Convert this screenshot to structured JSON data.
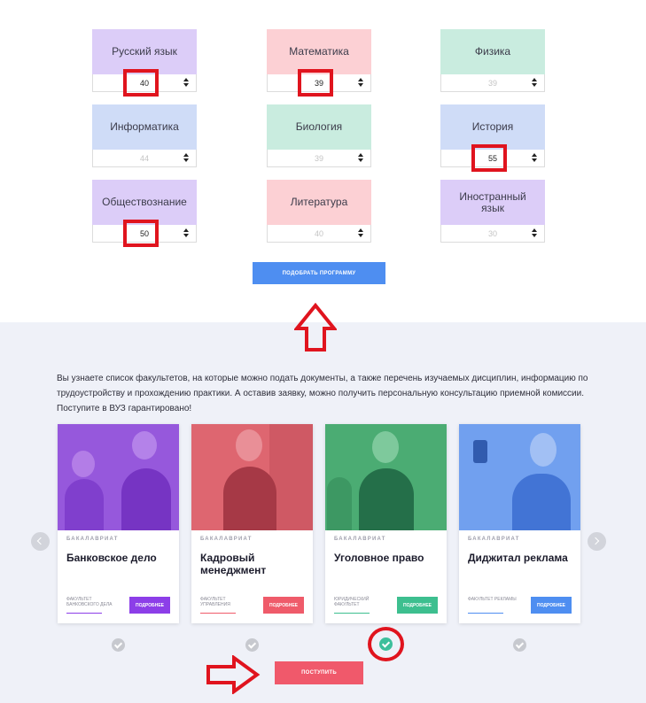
{
  "subjects": [
    {
      "name": "Русский язык",
      "value": "40",
      "placeholder": false,
      "color": "purple",
      "highlighted": true
    },
    {
      "name": "Математика",
      "value": "39",
      "placeholder": false,
      "color": "pink",
      "highlighted": true
    },
    {
      "name": "Физика",
      "value": "39",
      "placeholder": true,
      "color": "green",
      "highlighted": false
    },
    {
      "name": "Информатика",
      "value": "44",
      "placeholder": true,
      "color": "blue",
      "highlighted": false
    },
    {
      "name": "Биология",
      "value": "39",
      "placeholder": true,
      "color": "green",
      "highlighted": false
    },
    {
      "name": "История",
      "value": "55",
      "placeholder": false,
      "color": "blue",
      "highlighted": true
    },
    {
      "name": "Обществознание",
      "value": "50",
      "placeholder": false,
      "color": "purple",
      "highlighted": true
    },
    {
      "name": "Литература",
      "value": "40",
      "placeholder": true,
      "color": "pink",
      "highlighted": false
    },
    {
      "name": "Иностранный язык",
      "value": "30",
      "placeholder": true,
      "color": "purple",
      "highlighted": false
    }
  ],
  "pick_button": "ПОДОБРАТЬ ПРОГРАММУ",
  "intro_text": "Вы узнаете список факультетов, на которые можно подать документы, а также перечень изучаемых дисциплин, информацию по трудоустройству и прохождению практики. А оставив заявку, можно получить персональную консультацию приемной комиссии. Поступите в ВУЗ гарантировано!",
  "programs": [
    {
      "level": "БАКАЛАВРИАТ",
      "title": "Банковское дело",
      "faculty": "ФАКУЛЬТЕТ БАНКОВСКОГО ДЕЛА",
      "button": "ПОДРОБНЕЕ",
      "accent": "#8c3ee8",
      "selected": false
    },
    {
      "level": "БАКАЛАВРИАТ",
      "title": "Кадровый менеджмент",
      "faculty": "ФАКУЛЬТЕТ УПРАВЛЕНИЯ",
      "button": "ПОДРОБНЕЕ",
      "accent": "#ef5b6a",
      "selected": false
    },
    {
      "level": "БАКАЛАВРИАТ",
      "title": "Уголовное право",
      "faculty": "ЮРИДИЧЕСКИЙ ФАКУЛЬТЕТ",
      "button": "ПОДРОБНЕЕ",
      "accent": "#3dbf8f",
      "selected": true
    },
    {
      "level": "БАКАЛАВРИАТ",
      "title": "Диджитал реклама",
      "faculty": "ФАКУЛЬТЕТ РЕКЛАМЫ",
      "button": "ПОДРОБНЕЕ",
      "accent": "#4e8ef1",
      "selected": false
    }
  ],
  "apply_button": "ПОСТУПИТЬ",
  "icons": {
    "check": "check-icon",
    "prev": "chevron-left-icon",
    "next": "chevron-right-icon",
    "spinner": "spinner-arrows-icon",
    "annotation_arrow": "outline-arrow-icon"
  }
}
